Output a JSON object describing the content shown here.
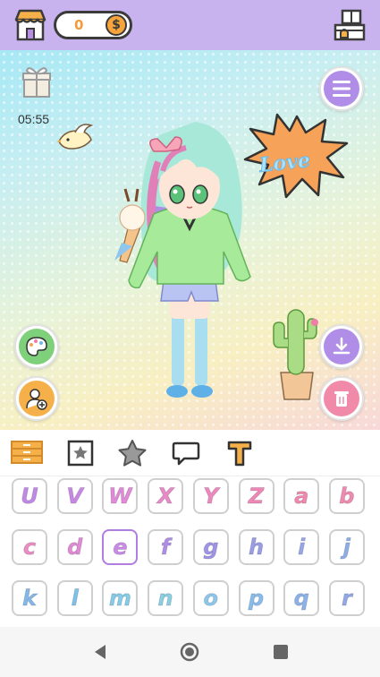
{
  "topbar": {
    "coin_count": "0",
    "coin_symbol": "$"
  },
  "scene": {
    "timer": "05:55",
    "sticker_text": "Love"
  },
  "tabs": [
    {
      "name": "furniture-tab",
      "icon": "drawer-icon",
      "active": true
    },
    {
      "name": "star-frame-tab",
      "icon": "star-frame-icon"
    },
    {
      "name": "star-tab",
      "icon": "star-icon"
    },
    {
      "name": "speech-bubble-tab",
      "icon": "speech-bubble-icon"
    },
    {
      "name": "text-tab",
      "icon": "text-icon"
    }
  ],
  "letters": [
    {
      "ch": "U",
      "color": "#c089e6"
    },
    {
      "ch": "V",
      "color": "#c889e6"
    },
    {
      "ch": "W",
      "color": "#e08ad8"
    },
    {
      "ch": "X",
      "color": "#e88ac8"
    },
    {
      "ch": "Y",
      "color": "#ee89c0"
    },
    {
      "ch": "Z",
      "color": "#f087b6"
    },
    {
      "ch": "a",
      "color": "#f088b0"
    },
    {
      "ch": "b",
      "color": "#f08ab0"
    },
    {
      "ch": "c",
      "color": "#ec8cc4"
    },
    {
      "ch": "d",
      "color": "#e08ad6"
    },
    {
      "ch": "e",
      "color": "#c88be8"
    },
    {
      "ch": "f",
      "color": "#b08ee8"
    },
    {
      "ch": "g",
      "color": "#a094e6"
    },
    {
      "ch": "h",
      "color": "#9a9ce6"
    },
    {
      "ch": "i",
      "color": "#96a6e8"
    },
    {
      "ch": "j",
      "color": "#8eaee8"
    },
    {
      "ch": "k",
      "color": "#84b8ea"
    },
    {
      "ch": "l",
      "color": "#7ec2ec"
    },
    {
      "ch": "m",
      "color": "#84cce8"
    },
    {
      "ch": "n",
      "color": "#88d0e2"
    },
    {
      "ch": "o",
      "color": "#8cc8ec"
    },
    {
      "ch": "p",
      "color": "#88bcec"
    },
    {
      "ch": "q",
      "color": "#8cb2ea"
    },
    {
      "ch": "r",
      "color": "#92a8e8"
    }
  ],
  "selected_letter": "e",
  "colors": {
    "topbar": "#c9b3ef",
    "accent_purple": "#a37ae6",
    "accent_pink": "#f08aa8",
    "button_orange": "#f6b04a"
  }
}
